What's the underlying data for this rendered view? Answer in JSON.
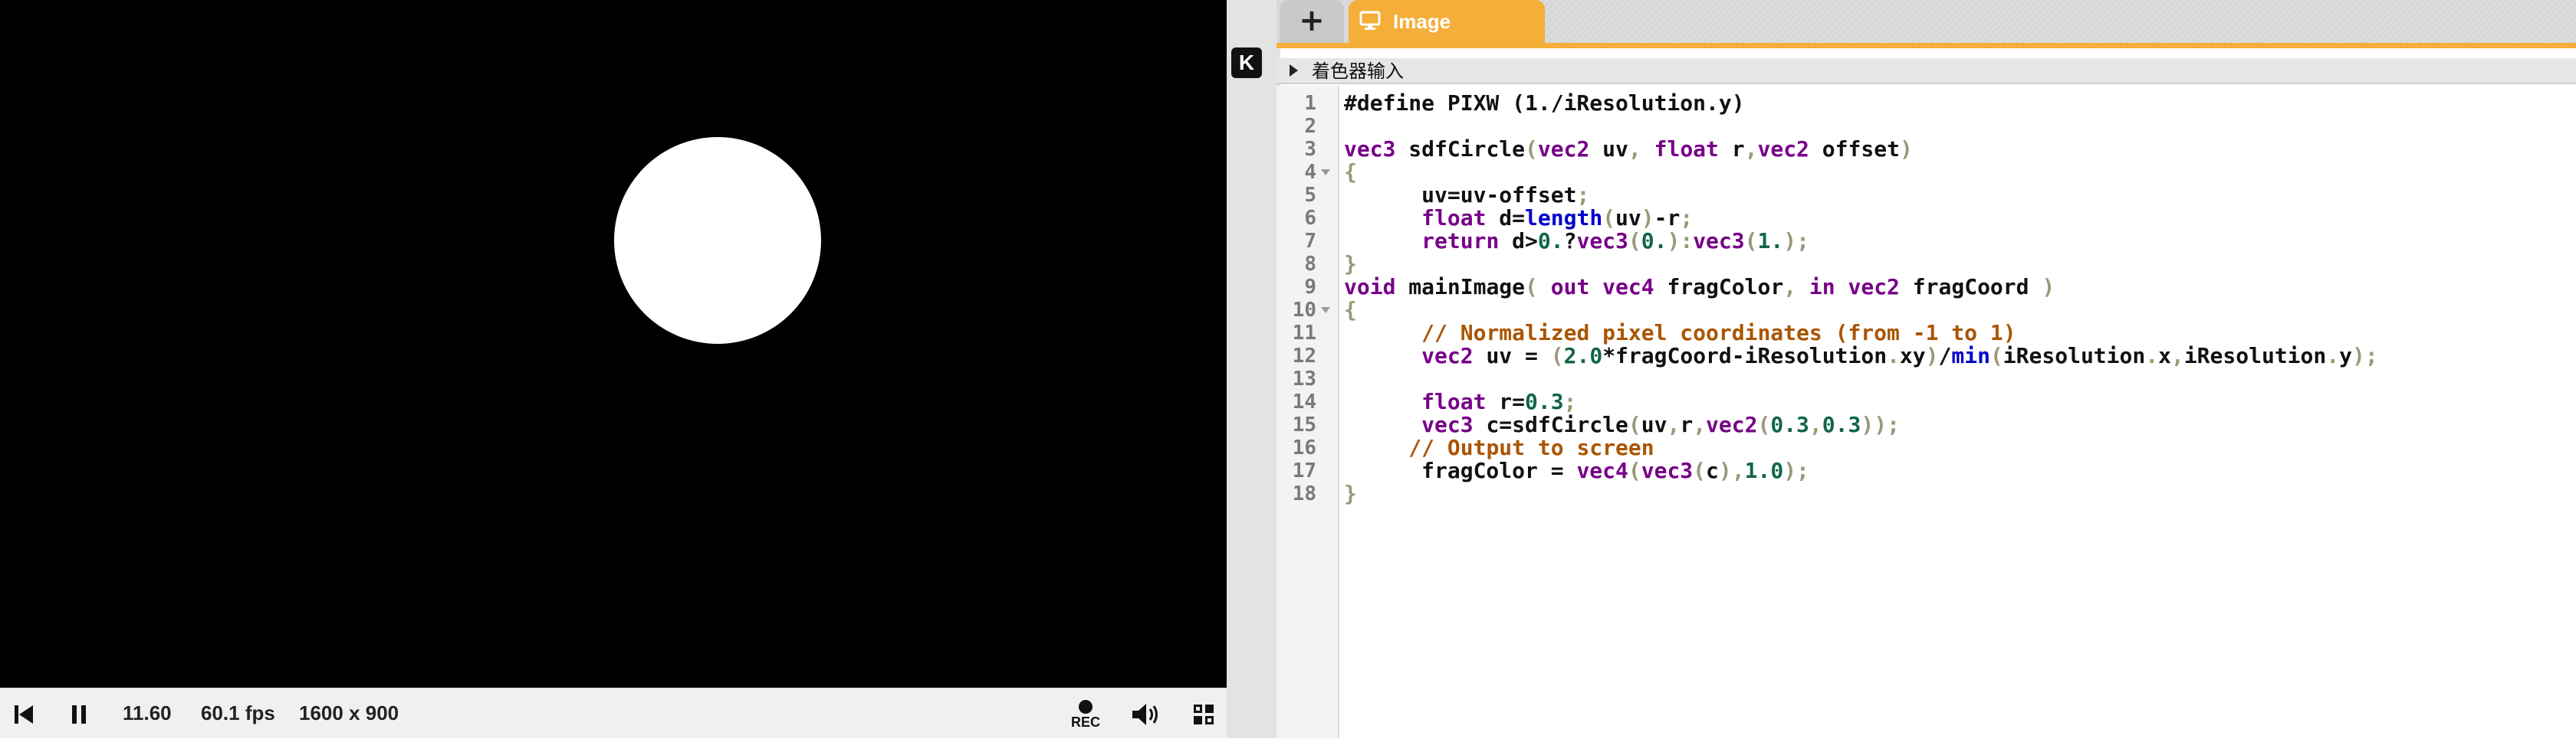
{
  "preview": {
    "time": "11.60",
    "fps": "60.1 fps",
    "resolution": "1600 x 900",
    "rec_label": "REC"
  },
  "logo_letter": "K",
  "tabs": {
    "add_label": "+",
    "active_label": "Image"
  },
  "shader_inputs_label": "着色器输入",
  "colors": {
    "accent": "#f5ae3a",
    "canvas_bg": "#000000",
    "circle": "#ffffff"
  },
  "code": {
    "line_numbers": [
      "1",
      "2",
      "3",
      "4",
      "5",
      "6",
      "7",
      "8",
      "9",
      "10",
      "11",
      "12",
      "13",
      "14",
      "15",
      "16",
      "17",
      "18"
    ],
    "lines": [
      [
        [
          "#define PIXW (1./iResolution.y)",
          ""
        ]
      ],
      [],
      [
        [
          "vec3",
          "kw"
        ],
        [
          " sdfCircle",
          ""
        ],
        [
          "(",
          "pn"
        ],
        [
          "vec2",
          "kw"
        ],
        [
          " uv",
          ""
        ],
        [
          ",",
          "pn"
        ],
        [
          " ",
          ""
        ],
        [
          "float",
          "kw"
        ],
        [
          " r",
          ""
        ],
        [
          ",",
          "pn"
        ],
        [
          "vec2",
          "kw"
        ],
        [
          " offset",
          ""
        ],
        [
          ")",
          "pn"
        ]
      ],
      [
        [
          "{",
          "pn"
        ]
      ],
      [
        [
          "      uv=uv-offset",
          ""
        ],
        [
          ";",
          "pn"
        ]
      ],
      [
        [
          "      ",
          ""
        ],
        [
          "float",
          "kw"
        ],
        [
          " d=",
          ""
        ],
        [
          "length",
          "fn"
        ],
        [
          "(",
          "pn"
        ],
        [
          "uv",
          ""
        ],
        [
          ")",
          "pn"
        ],
        [
          "-r",
          ""
        ],
        [
          ";",
          "pn"
        ]
      ],
      [
        [
          "      ",
          ""
        ],
        [
          "return",
          "kw"
        ],
        [
          " d>",
          ""
        ],
        [
          "0.",
          "num"
        ],
        [
          "?",
          ""
        ],
        [
          "vec3",
          "kw"
        ],
        [
          "(",
          "pn"
        ],
        [
          "0.",
          "num"
        ],
        [
          "):",
          "pn"
        ],
        [
          "vec3",
          "kw"
        ],
        [
          "(",
          "pn"
        ],
        [
          "1.",
          "num"
        ],
        [
          ");",
          "pn"
        ]
      ],
      [
        [
          "}",
          "pn"
        ]
      ],
      [
        [
          "void",
          "kw"
        ],
        [
          " mainImage",
          ""
        ],
        [
          "( ",
          "pn"
        ],
        [
          "out",
          "kw"
        ],
        [
          " ",
          ""
        ],
        [
          "vec4",
          "kw"
        ],
        [
          " fragColor",
          ""
        ],
        [
          ", ",
          "pn"
        ],
        [
          "in",
          "kw"
        ],
        [
          " ",
          ""
        ],
        [
          "vec2",
          "kw"
        ],
        [
          " fragCoord ",
          ""
        ],
        [
          ")",
          "pn"
        ]
      ],
      [
        [
          "{",
          "pn"
        ]
      ],
      [
        [
          "      ",
          ""
        ],
        [
          "// Normalized pixel coordinates (from -1 to 1)",
          "cm"
        ]
      ],
      [
        [
          "      ",
          ""
        ],
        [
          "vec2",
          "kw"
        ],
        [
          " uv = ",
          ""
        ],
        [
          "(",
          "pn"
        ],
        [
          "2.0",
          "num"
        ],
        [
          "*fragCoord-iResolution",
          ""
        ],
        [
          ".",
          "pn"
        ],
        [
          "xy",
          ""
        ],
        [
          ")",
          "pn"
        ],
        [
          "/",
          ""
        ],
        [
          "min",
          "fn"
        ],
        [
          "(",
          "pn"
        ],
        [
          "iResolution",
          ""
        ],
        [
          ".",
          "pn"
        ],
        [
          "x",
          ""
        ],
        [
          ",",
          "pn"
        ],
        [
          "iResolution",
          ""
        ],
        [
          ".",
          "pn"
        ],
        [
          "y",
          ""
        ],
        [
          ");",
          "pn"
        ]
      ],
      [],
      [
        [
          "      ",
          ""
        ],
        [
          "float",
          "kw"
        ],
        [
          " r=",
          ""
        ],
        [
          "0.3",
          "num"
        ],
        [
          ";",
          "pn"
        ]
      ],
      [
        [
          "      ",
          ""
        ],
        [
          "vec3",
          "kw"
        ],
        [
          " c=sdfCircle",
          ""
        ],
        [
          "(",
          "pn"
        ],
        [
          "uv",
          ""
        ],
        [
          ",",
          "pn"
        ],
        [
          "r",
          ""
        ],
        [
          ",",
          "pn"
        ],
        [
          "vec2",
          "kw"
        ],
        [
          "(",
          "pn"
        ],
        [
          "0.3",
          "num"
        ],
        [
          ",",
          "pn"
        ],
        [
          "0.3",
          "num"
        ],
        [
          "));",
          "pn"
        ]
      ],
      [
        [
          "     ",
          ""
        ],
        [
          "// Output to screen",
          "cm"
        ]
      ],
      [
        [
          "      fragColor = ",
          ""
        ],
        [
          "vec4",
          "kw"
        ],
        [
          "(",
          "pn"
        ],
        [
          "vec3",
          "kw"
        ],
        [
          "(",
          "pn"
        ],
        [
          "c",
          ""
        ],
        [
          "),",
          "pn"
        ],
        [
          "1.0",
          "num"
        ],
        [
          ");",
          "pn"
        ]
      ],
      [
        [
          "}",
          "pn"
        ]
      ]
    ]
  }
}
